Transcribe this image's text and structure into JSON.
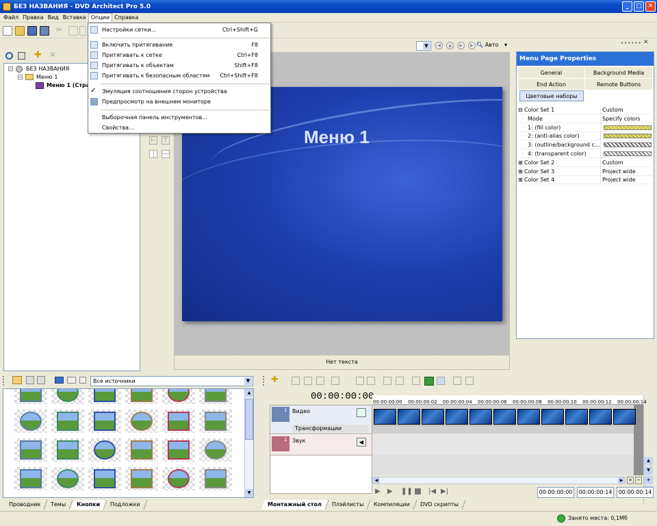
{
  "title": "БЕЗ НАЗВАНИЯ - DVD Architect Pro 5.0",
  "menubar": [
    "Файл",
    "Правка",
    "Вид",
    "Вставка",
    "Опции",
    "Справка"
  ],
  "options_menu": {
    "items": [
      {
        "label": "Настройки сетки...",
        "shortcut": "Ctrl+Shift+G",
        "icon": "grid-icon"
      },
      {
        "label": "Включить притягивание",
        "shortcut": "F8",
        "icon": "snap-icon"
      },
      {
        "label": "Притягивать к сетке",
        "shortcut": "Ctrl+F8",
        "icon": "snap-grid-icon"
      },
      {
        "label": "Притягивать к объектам",
        "shortcut": "Shift+F8",
        "icon": "snap-objects-icon"
      },
      {
        "label": "Притягивать к безопасным областям",
        "shortcut": "Ctrl+Shift+F8",
        "icon": "snap-safe-icon"
      },
      {
        "label": "Эмуляция соотношения сторон устройства",
        "shortcut": "",
        "icon": "checkmark-icon"
      },
      {
        "label": "Предпросмотр на внешнем мониторе",
        "shortcut": "",
        "icon": "monitor-icon"
      },
      {
        "label": "Выборочная панель инструментов...",
        "shortcut": "",
        "icon": ""
      },
      {
        "label": "Свойства...",
        "shortcut": "",
        "icon": ""
      }
    ]
  },
  "project_tree": {
    "root": "БЕЗ НАЗВАНИЯ",
    "child": "Меню 1",
    "grandchild": "Меню 1 (Стра"
  },
  "preview": {
    "zoom_label": "Авто",
    "menu_title": "Меню 1",
    "status": "Нет текста"
  },
  "properties": {
    "header": "Menu Page Properties",
    "tabs": [
      "General",
      "Background Media",
      "End Action",
      "Remote Buttons",
      "Цветовые наборы"
    ],
    "rows": [
      {
        "key": "Color Set 1",
        "value": "Custom",
        "expand": "⊟"
      },
      {
        "key": "Mode",
        "value": "Specify colors",
        "expand": ""
      },
      {
        "key": "1: (fill color)",
        "value": "",
        "expand": ""
      },
      {
        "key": "2: (anti-alias color)",
        "value": "",
        "expand": ""
      },
      {
        "key": "3: (outline/background c...",
        "value": "",
        "expand": ""
      },
      {
        "key": "4: (transparent color)",
        "value": "",
        "expand": ""
      },
      {
        "key": "Color Set 2",
        "value": "Custom",
        "expand": "⊞"
      },
      {
        "key": "Color Set 3",
        "value": "Project wide",
        "expand": "⊞"
      },
      {
        "key": "Color Set 4",
        "value": "Project wide",
        "expand": "⊞"
      }
    ]
  },
  "library": {
    "source_select": "Все источники",
    "tabs": [
      "Проводник",
      "Темы",
      "Кнопки",
      "Подложки"
    ]
  },
  "timeline": {
    "timecode": "00:00:00:00",
    "ticks": [
      "00:00:00:00",
      "00:00:00:02",
      "00:00:00:04",
      "00:00:00:06",
      "00:00:00:08",
      "00:00:00:10",
      "00:00:00:12",
      "00:00:00:14"
    ],
    "video_track": "Видео",
    "transform_label": "Трансформации",
    "audio_track": "Звук",
    "track_number_video": "1",
    "track_number_audio": "1",
    "time_start": "00:00:00:00",
    "time_end": "00:00:00:14",
    "time_length": "00:00:00:14",
    "tabs": [
      "Монтажный стол",
      "Плэйлисты",
      "Компиляции",
      "DVD скрипты"
    ]
  },
  "statusbar": {
    "space": "Занято места: 0,1Мб"
  },
  "colors": {
    "accent": "#2b70d8",
    "preview_bg": "#1e3fa8"
  }
}
